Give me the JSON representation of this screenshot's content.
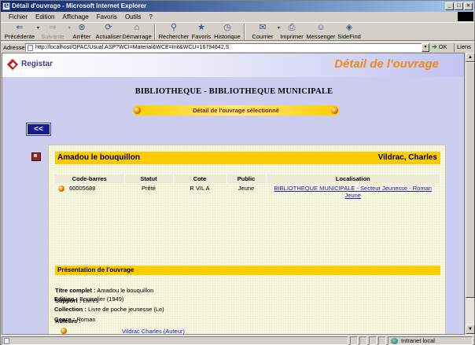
{
  "window": {
    "title": "Détail d'ouvrage - Microsoft Internet Explorer",
    "buttons": [
      "_",
      "□",
      "×"
    ]
  },
  "menu": [
    "Fichier",
    "Edition",
    "Affichage",
    "Favoris",
    "Outils",
    "?"
  ],
  "toolbar": {
    "items": [
      {
        "label": "Précédente",
        "icon": "back-arrow-icon"
      },
      {
        "label": "Suivante",
        "icon": "forward-arrow-icon"
      },
      {
        "label": "Arrêter",
        "icon": "stop-icon"
      },
      {
        "label": "Actualiser",
        "icon": "refresh-icon"
      },
      {
        "label": "Démarrage",
        "icon": "home-icon"
      },
      {
        "label": "Rechercher",
        "icon": "search-icon"
      },
      {
        "label": "Favoris",
        "icon": "favorites-icon"
      },
      {
        "label": "Historique",
        "icon": "history-icon"
      },
      {
        "label": "Courrier",
        "icon": "mail-icon"
      },
      {
        "label": "Imprimer",
        "icon": "print-icon"
      },
      {
        "label": "Messenger",
        "icon": "messenger-icon"
      },
      {
        "label": "SideFind",
        "icon": "sidefind-icon"
      }
    ]
  },
  "address": {
    "label": "Adresse",
    "url": "http://localhost/OPAC/Usual.ASP?WCI=Material&WCE=Init&WCU=16794642,S",
    "go": "OK",
    "links": "Liens"
  },
  "page": {
    "logo": "Registar",
    "title": "Détail de l'ouvrage",
    "library": "BIBLIOTHEQUE - BIBLIOTHEQUE MUNICIPALE",
    "selected_label": "Détail de l'ouvrage sélectionné",
    "back": "<<"
  },
  "book": {
    "title": "Amadou le bouquillon",
    "author": "Vildrac, Charles",
    "holdings_headers": [
      "Code-barres",
      "Statut",
      "Cote",
      "Public",
      "Localisation"
    ],
    "holdings": [
      {
        "barcode": "60005688",
        "status": "Prêté",
        "cote": "R VIL A",
        "public": "Jeune",
        "location": "BIBLIOTHEQUE MUNICIPALE - Secteur Jeunesse - Roman Jeune"
      }
    ],
    "section": "Présentation de l'ouvrage",
    "fields": {
      "titre_label": "Titre complet :",
      "titre": "Amadou le bouquillon",
      "support_label": "Support :",
      "support": "Livres",
      "auteurs_label": "Auteurs :",
      "auteur_link": "Vildrac Charles (Auteur)",
      "edition_label": "Edition :",
      "edition": "Bourrelier (1949)",
      "collection_label": "Collection :",
      "collection": "Livre de poche jeunesse (Le)",
      "genre_label": "Genre :",
      "genre": "Roman"
    }
  },
  "status": {
    "zone": "Intranet local"
  }
}
